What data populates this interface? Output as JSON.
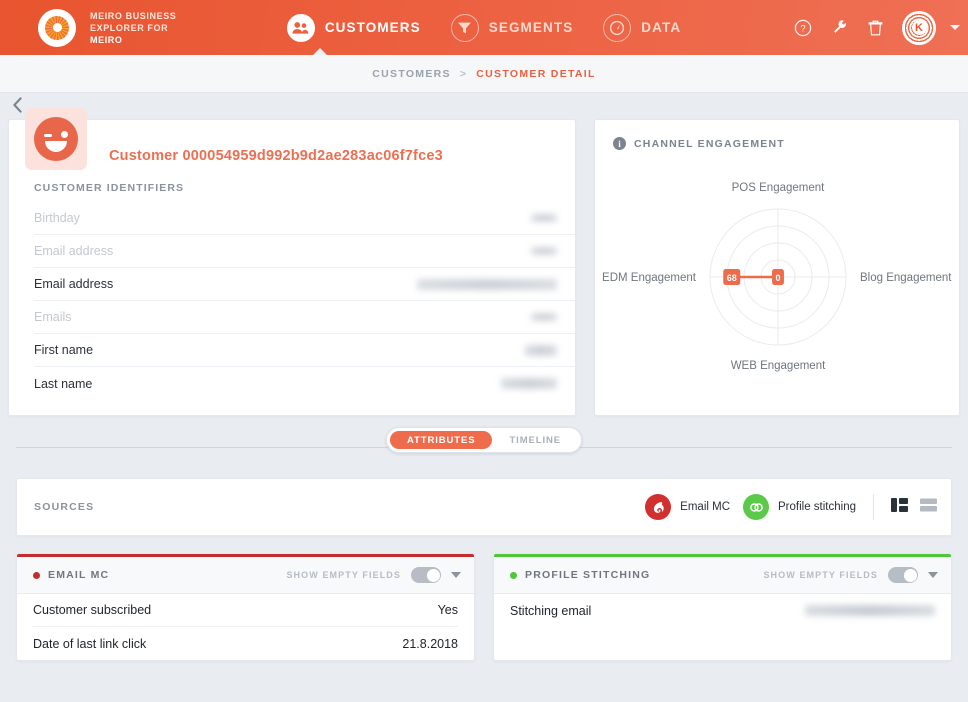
{
  "brand": {
    "line1": "MEIRO BUSINESS",
    "line2": "EXPLORER FOR",
    "line3": "MEIRO",
    "logo_icon": "meiro-spiral-logo"
  },
  "nav": {
    "items": [
      {
        "label": "CUSTOMERS",
        "icon": "customers-icon",
        "active": true
      },
      {
        "label": "SEGMENTS",
        "icon": "funnel-icon",
        "active": false
      },
      {
        "label": "DATA",
        "icon": "gauge-icon",
        "active": false
      }
    ],
    "actions": [
      {
        "icon": "help-circle-icon",
        "label": "?"
      },
      {
        "icon": "wrench-icon",
        "label": ""
      },
      {
        "icon": "trash-icon",
        "label": ""
      }
    ],
    "user": {
      "initial": "K",
      "icon": "user-avatar",
      "caret": "chevron-down-icon"
    }
  },
  "breadcrumb": {
    "parent": "CUSTOMERS",
    "separator": ">",
    "current": "CUSTOMER DETAIL"
  },
  "back_button": {
    "icon": "chevron-left-icon",
    "label": "‹"
  },
  "customer": {
    "avatar_icon": "winking-smiley-avatar",
    "title": "Customer 000054959d992b9d2ae283ac06f7fce3",
    "identifiers_label": "CUSTOMER IDENTIFIERS",
    "identifiers": [
      {
        "key": "Birthday",
        "value": "",
        "empty": true,
        "redacted": true
      },
      {
        "key": "Email address",
        "value": "",
        "empty": true,
        "redacted": true
      },
      {
        "key": "Email address",
        "value": "",
        "empty": false,
        "redacted": true
      },
      {
        "key": "Emails",
        "value": "",
        "empty": true,
        "redacted": true
      },
      {
        "key": "First name",
        "value": "",
        "empty": false,
        "redacted": true
      },
      {
        "key": "Last name",
        "value": "",
        "empty": false,
        "redacted": true
      }
    ]
  },
  "channel_engagement": {
    "info_icon": "info-icon",
    "title": "CHANNEL ENGAGEMENT"
  },
  "chart_data": {
    "type": "radar",
    "title": "CHANNEL ENGAGEMENT",
    "categories": [
      "POS Engagement",
      "Blog Engagement",
      "WEB Engagement",
      "EDM Engagement"
    ],
    "values": [
      0,
      0,
      0,
      68
    ],
    "labels": [
      "0",
      "0",
      "0",
      "68"
    ],
    "rings": 4,
    "rmax": 100,
    "grid": true,
    "legend": "none",
    "series": [
      {
        "name": "Engagement",
        "values": [
          0,
          0,
          0,
          68
        ]
      }
    ],
    "accent_color": "#ee6b4c"
  },
  "tabs": {
    "items": [
      {
        "label": "ATTRIBUTES",
        "active": true
      },
      {
        "label": "TIMELINE",
        "active": false
      }
    ]
  },
  "sources_bar": {
    "label": "SOURCES",
    "chips": [
      {
        "label": "Email MC",
        "icon": "mailchimp-icon",
        "color": "#d22f2f"
      },
      {
        "label": "Profile stitching",
        "icon": "stitching-icon",
        "color": "#5bc94a"
      }
    ],
    "views": [
      {
        "icon": "grid-view-icon",
        "active": true
      },
      {
        "icon": "list-view-icon",
        "active": false
      }
    ]
  },
  "panels": [
    {
      "title": "EMAIL MC",
      "accent": "#c32d2d",
      "show_empty_label": "SHOW EMPTY FIELDS",
      "toggle_on": true,
      "caret_icon": "chevron-down-icon",
      "rows": [
        {
          "key": "Customer subscribed",
          "value": "Yes",
          "redacted": false
        },
        {
          "key": "Date of last link click",
          "value": "21.8.2018",
          "redacted": false
        }
      ]
    },
    {
      "title": "PROFILE STITCHING",
      "accent": "#4ec73a",
      "show_empty_label": "SHOW EMPTY FIELDS",
      "toggle_on": true,
      "caret_icon": "chevron-down-icon",
      "rows": [
        {
          "key": "Stitching email",
          "value": "",
          "redacted": true
        }
      ]
    }
  ],
  "colors": {
    "brand_orange": "#ec6040",
    "accent": "#ee6b4c",
    "page_bg": "#e9edf2",
    "mc_red": "#c32d2d",
    "ps_green": "#4ec73a"
  }
}
